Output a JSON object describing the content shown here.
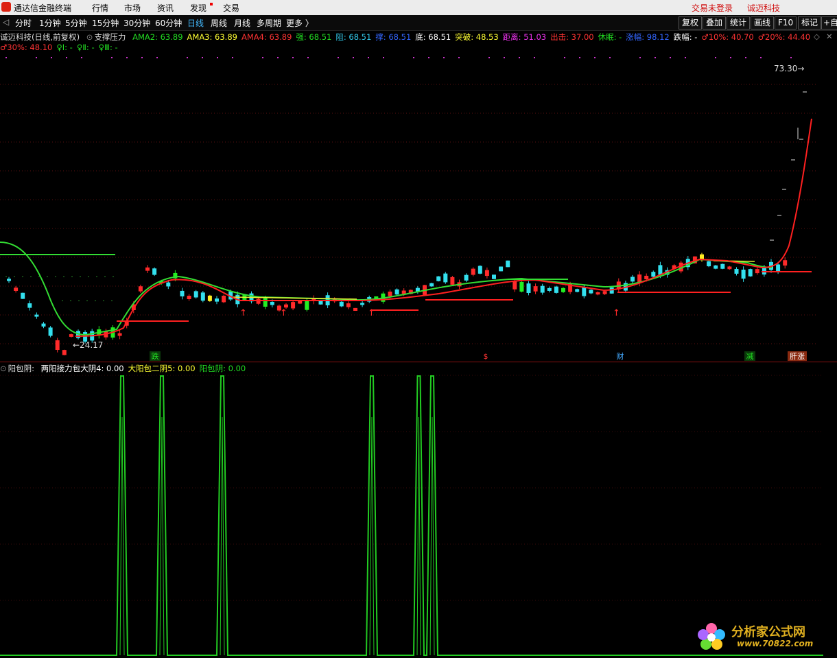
{
  "menubar": {
    "app_title": "通达信金融终端",
    "items": [
      "行情",
      "市场",
      "资讯",
      "发现",
      "交易"
    ],
    "right": [
      "交易未登录",
      "诚迈科技"
    ]
  },
  "toolbar": {
    "periods": [
      "分时",
      "1分钟",
      "5分钟",
      "15分钟",
      "30分钟",
      "60分钟",
      "日线",
      "周线",
      "月线",
      "多周期",
      "更多 〉"
    ],
    "active": "日线",
    "right_buttons": [
      "复权",
      "叠加",
      "统计",
      "画线",
      "F10",
      "标记",
      "+自"
    ]
  },
  "indicator_row1": {
    "title": "诚迈科技(日线,前复权)",
    "formula": "支撑压力",
    "items": [
      {
        "label": "AMA2: 63.89",
        "color": "#22dd22"
      },
      {
        "label": "AMA3: 63.89",
        "color": "#ffff33"
      },
      {
        "label": "AMA4: 63.89",
        "color": "#ff3333"
      },
      {
        "label": "强: 68.51",
        "color": "#22dd22"
      },
      {
        "label": "阻: 68.51",
        "color": "#33ccee"
      },
      {
        "label": "撑: 68.51",
        "color": "#3366ff"
      },
      {
        "label": "底: 68.51",
        "color": "#ffffff"
      },
      {
        "label": "突破: 48.53",
        "color": "#ffff33"
      },
      {
        "label": "距离: 51.03",
        "color": "#ee33ee"
      },
      {
        "label": "出击: 37.00",
        "color": "#ff3333"
      },
      {
        "label": "休眠: -",
        "color": "#22dd22"
      },
      {
        "label": "涨幅: 98.12",
        "color": "#3366ff"
      },
      {
        "label": "跌幅: -",
        "color": "#ffffff"
      },
      {
        "label": "♂10%: 40.70",
        "color": "#ff3333"
      },
      {
        "label": "♂20%: 44.40",
        "color": "#ff3333"
      }
    ]
  },
  "indicator_row2": {
    "items": [
      {
        "label": "♂30%: 48.10",
        "color": "#ff3333"
      },
      {
        "label": "♀Ⅰ: -",
        "color": "#22dd22"
      },
      {
        "label": "♀Ⅱ: -",
        "color": "#22dd22"
      },
      {
        "label": "♀Ⅲ: -",
        "color": "#22dd22"
      }
    ]
  },
  "price_labels": {
    "high": "73.30",
    "low": "←24.17"
  },
  "event_markers": [
    {
      "text": "跌",
      "color": "#22dd22",
      "bg": "#0a3a0a"
    },
    {
      "text": "$",
      "color": "#ff3333",
      "bg": ""
    },
    {
      "text": "财",
      "color": "#44aaff",
      "bg": ""
    },
    {
      "text": "减",
      "color": "#22dd22",
      "bg": "#0a3a0a"
    },
    {
      "text": "肝涨",
      "color": "#ffffff",
      "bg": "#8a2a10"
    }
  ],
  "sub_indicator": {
    "title": "阳包阴:",
    "items": [
      {
        "label": "两阳接力包大阴4: 0.00",
        "color": "#ffffff"
      },
      {
        "label": "大阳包二阴5: 0.00",
        "color": "#ffff33"
      },
      {
        "label": "阳包阴: 0.00",
        "color": "#22dd22"
      }
    ],
    "line_color": "#22cc22"
  },
  "watermark": {
    "name": "分析家公式网",
    "url": "www.70822.com"
  }
}
